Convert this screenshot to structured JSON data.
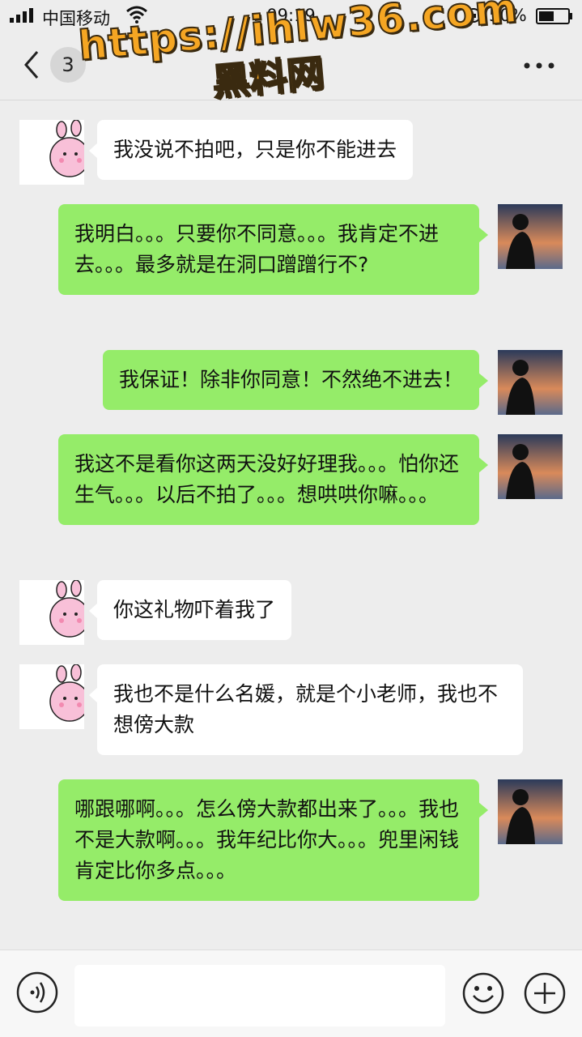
{
  "status_bar": {
    "carrier": "中国移动",
    "time": "09:19",
    "battery_percent": "50%",
    "icons": [
      "signal-icon",
      "wifi-icon",
      "rotation-lock-icon",
      "battery-icon"
    ]
  },
  "nav": {
    "unread_count": "3",
    "title": "",
    "icons": [
      "back-arrow-icon",
      "more-icon"
    ]
  },
  "watermark": {
    "url": "https://ihlw36.com",
    "name": "黑料网"
  },
  "messages": [
    {
      "side": "in",
      "text": "我没说不拍吧，只是你不能进去"
    },
    {
      "side": "out",
      "text": "我明白。。。只要你不同意。。。我肯定不进去。。。最多就是在洞口蹭蹭行不?"
    },
    {
      "side": "out",
      "text": "我保证！除非你同意！不然绝不进去！"
    },
    {
      "side": "out",
      "text": "我这不是看你这两天没好好理我。。。怕你还生气。。。以后不拍了。。。想哄哄你嘛。。。"
    },
    {
      "side": "in",
      "text": "你这礼物吓着我了"
    },
    {
      "side": "in",
      "text": "我也不是什么名媛，就是个小老师，我也不想傍大款"
    },
    {
      "side": "out",
      "text": "哪跟哪啊。。。怎么傍大款都出来了。。。我也不是大款啊。。。我年纪比你大。。。兜里闲钱肯定比你多点。。。"
    }
  ],
  "input_bar": {
    "placeholder": "",
    "icons": [
      "voice-icon",
      "emoji-icon",
      "plus-icon"
    ]
  },
  "colors": {
    "background": "#ededed",
    "outgoing_bubble": "#95ec69",
    "incoming_bubble": "#ffffff",
    "watermark": "#f5a623"
  }
}
